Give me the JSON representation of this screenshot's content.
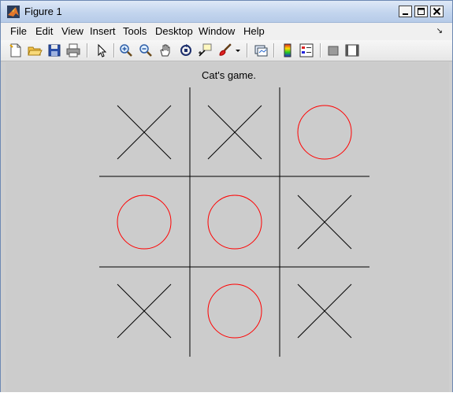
{
  "window": {
    "title": "Figure 1",
    "controls": [
      "minimize",
      "maximize",
      "close"
    ]
  },
  "menu": {
    "items": [
      "File",
      "Edit",
      "View",
      "Insert",
      "Tools",
      "Desktop",
      "Window",
      "Help"
    ]
  },
  "toolbar": {
    "icons": [
      "new-figure-icon",
      "open-file-icon",
      "save-icon",
      "print-icon",
      "pointer-icon",
      "zoom-in-icon",
      "zoom-out-icon",
      "pan-hand-icon",
      "rotate-3d-icon",
      "data-cursor-icon",
      "brush-icon",
      "brush-dropdown-icon",
      "link-plot-icon",
      "colorbar-icon",
      "legend-icon",
      "hide-plot-tools-icon",
      "show-plot-tools-icon"
    ]
  },
  "game": {
    "title": "Cat's game.",
    "board": [
      [
        "X",
        "X",
        "O"
      ],
      [
        "O",
        "O",
        "X"
      ],
      [
        "X",
        "O",
        "X"
      ]
    ],
    "colors": {
      "x": "#000000",
      "o": "#ff0000",
      "grid": "#000000"
    }
  }
}
